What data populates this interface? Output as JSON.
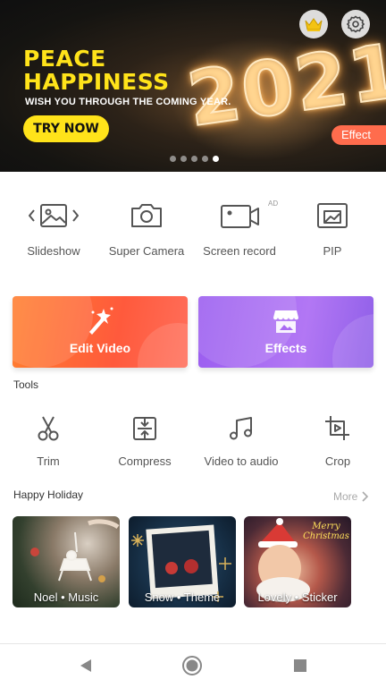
{
  "banner": {
    "headline_line1": "PEACE",
    "headline_line2": "HAPPINESS",
    "subtitle": "WISH YOU THROUGH THE COMING YEAR.",
    "cta": "TRY NOW",
    "year": "2021",
    "effect_tag": "Effect",
    "slides": 5,
    "active_slide": 5,
    "icons": [
      "crown-icon",
      "gear-icon"
    ],
    "colors": {
      "headline": "#ffe31a",
      "cta_bg": "#ffe31a",
      "effect_tag": "#ff6c4d"
    }
  },
  "quick_tools": [
    {
      "label": "Slideshow",
      "icon": "slideshow-icon"
    },
    {
      "label": "Super Camera",
      "icon": "camera-icon"
    },
    {
      "label": "Screen record",
      "icon": "screen-record-icon",
      "badge": "AD"
    },
    {
      "label": "PIP",
      "icon": "pip-icon"
    }
  ],
  "cards": {
    "edit_video": "Edit Video",
    "effects": "Effects"
  },
  "tools": {
    "title": "Tools",
    "items": [
      {
        "label": "Trim",
        "icon": "scissors-icon"
      },
      {
        "label": "Compress",
        "icon": "compress-icon"
      },
      {
        "label": "Video to audio",
        "icon": "music-note-icon"
      },
      {
        "label": "Crop",
        "icon": "crop-icon"
      }
    ]
  },
  "holiday": {
    "title": "Happy Holiday",
    "more": "More",
    "templates": [
      {
        "label": "Noel • Music"
      },
      {
        "label": "Snow • Theme"
      },
      {
        "label": "Lovely • Sticker",
        "overlay_text": "Merry Christmas"
      }
    ]
  },
  "navbar": {
    "icons": [
      "back-triangle-icon",
      "home-circle-icon",
      "recents-square-icon"
    ]
  }
}
